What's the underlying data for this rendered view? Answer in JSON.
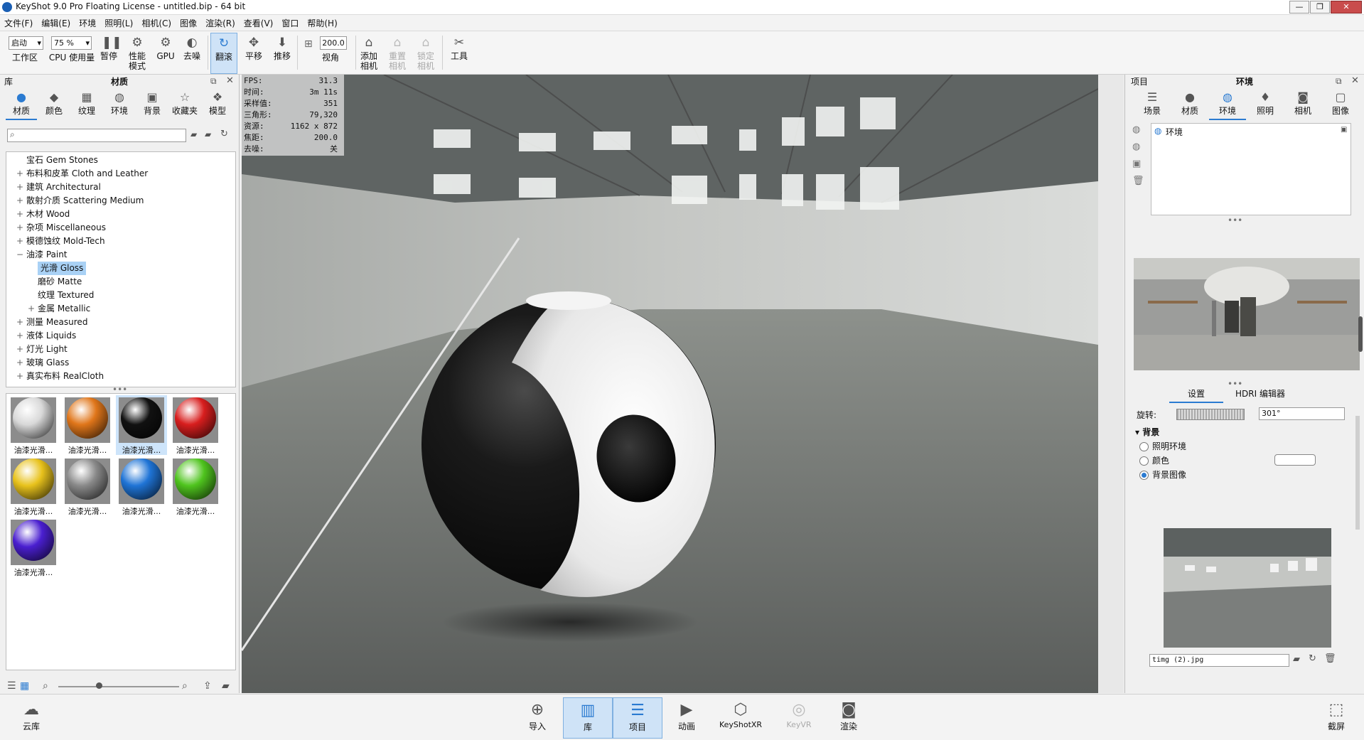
{
  "titlebar": {
    "title": "KeyShot 9.0 Pro Floating License  - untitled.bip  - 64 bit",
    "minimize": "—",
    "restore": "❐",
    "close": "✕"
  },
  "menu": [
    "文件(F)",
    "编辑(E)",
    "环境",
    "照明(L)",
    "相机(C)",
    "图像",
    "渲染(R)",
    "查看(V)",
    "窗口",
    "帮助(H)"
  ],
  "toolbar": {
    "mode_combo": "启动",
    "cpu_combo": "75 %",
    "workspace": "工作区",
    "cpu_usage": "CPU 使用量",
    "pause": "暂停",
    "performance": "性能\n模式",
    "gpu": "GPU",
    "denoise": "去噪",
    "tumble": "翻滚",
    "pan": "平移",
    "dolly": "推移",
    "fov_value": "200.0",
    "fov": "视角",
    "add_camera": "添加\n相机",
    "reset_camera": "重置\n相机",
    "lock_camera": "锁定\n相机",
    "tools": "工具"
  },
  "library": {
    "panel_label": "库",
    "panel_title": "材质",
    "tabs": [
      "材质",
      "颜色",
      "纹理",
      "环境",
      "背景",
      "收藏夹",
      "模型"
    ],
    "selected_tab": 0,
    "search_placeholder": "",
    "tree": [
      {
        "label": "宝石 Gem Stones",
        "level": 1,
        "expander": ""
      },
      {
        "label": "布料和皮革 Cloth and Leather",
        "level": 1,
        "expander": "+"
      },
      {
        "label": "建筑 Architectural",
        "level": 1,
        "expander": "+"
      },
      {
        "label": "散射介质 Scattering Medium",
        "level": 1,
        "expander": "+"
      },
      {
        "label": "木材 Wood",
        "level": 1,
        "expander": "+"
      },
      {
        "label": "杂项 Miscellaneous",
        "level": 1,
        "expander": "+"
      },
      {
        "label": "模德蚀纹 Mold-Tech",
        "level": 1,
        "expander": "+"
      },
      {
        "label": "油漆 Paint",
        "level": 1,
        "expander": "−"
      },
      {
        "label": "光滑 Gloss",
        "level": 2,
        "expander": "",
        "selected": true
      },
      {
        "label": "磨砂 Matte",
        "level": 2,
        "expander": ""
      },
      {
        "label": "纹理 Textured",
        "level": 2,
        "expander": ""
      },
      {
        "label": "金属 Metallic",
        "level": 2,
        "expander": "+"
      },
      {
        "label": "测量 Measured",
        "level": 1,
        "expander": "+"
      },
      {
        "label": "液体 Liquids",
        "level": 1,
        "expander": "+"
      },
      {
        "label": "灯光 Light",
        "level": 1,
        "expander": "+"
      },
      {
        "label": "玻璃 Glass",
        "level": 1,
        "expander": "+"
      },
      {
        "label": "真实布料 RealCloth",
        "level": 1,
        "expander": "+"
      }
    ],
    "materials": [
      {
        "name": "油漆光滑...",
        "color": "#d9d9d9",
        "selected": false
      },
      {
        "name": "油漆光滑...",
        "color": "#e0761a",
        "selected": false
      },
      {
        "name": "油漆光滑...",
        "color": "#111111",
        "selected": true
      },
      {
        "name": "油漆光滑...",
        "color": "#d81e1e",
        "selected": false
      },
      {
        "name": "油漆光滑...",
        "color": "#e8c21c",
        "selected": false
      },
      {
        "name": "油漆光滑...",
        "color": "#8a8a8a",
        "selected": false
      },
      {
        "name": "油漆光滑...",
        "color": "#1f74d6",
        "selected": false
      },
      {
        "name": "油漆光滑...",
        "color": "#4fc41e",
        "selected": false
      },
      {
        "name": "油漆光滑...",
        "color": "#4a1fd0",
        "selected": false
      }
    ]
  },
  "hud": [
    {
      "label": "FPS:",
      "value": "31.3"
    },
    {
      "label": "时间:",
      "value": "3m 11s"
    },
    {
      "label": "采样值:",
      "value": "351"
    },
    {
      "label": "三角形:",
      "value": "79,320"
    },
    {
      "label": "资源:",
      "value": "1162 x 872"
    },
    {
      "label": "焦距:",
      "value": "200.0"
    },
    {
      "label": "去噪:",
      "value": "关"
    }
  ],
  "project": {
    "panel_label": "项目",
    "panel_title": "环境",
    "tabs": [
      "场景",
      "材质",
      "环境",
      "照明",
      "相机",
      "图像"
    ],
    "selected_tab": 2,
    "env_item": "环境",
    "subtabs": [
      "设置",
      "HDRI 编辑器"
    ],
    "rotation_label": "旋转:",
    "rotation_value": "301°",
    "section_background": "背景",
    "bg_options": [
      "照明环境",
      "颜色",
      "背景图像"
    ],
    "bg_selected": 2,
    "bg_file": "timg (2).jpg"
  },
  "bottombar": {
    "cloud": "云库",
    "items": [
      "导入",
      "库",
      "项目",
      "动画",
      "KeyShotXR",
      "KeyVR",
      "渲染"
    ],
    "active": [
      1,
      2
    ],
    "disabled": [
      5
    ],
    "screenshot": "截屏"
  },
  "colors": {
    "accent": "#2b7bd1",
    "selection": "#a9d1f5"
  }
}
